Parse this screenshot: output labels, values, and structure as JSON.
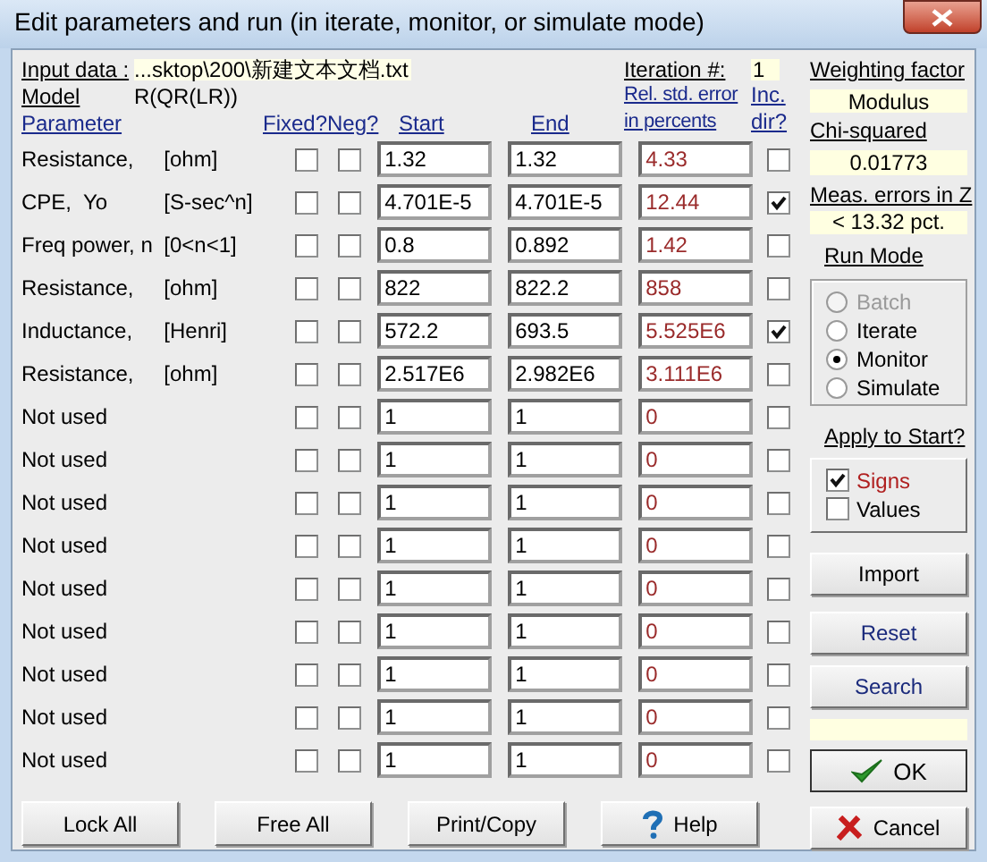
{
  "window": {
    "title": "Edit parameters and run (in iterate, monitor, or simulate mode)"
  },
  "header": {
    "input_data_label": "Input data :",
    "input_data_value": "...sktop\\200\\新建文本文档.txt",
    "model_label": "Model",
    "model_value": "R(QR(LR))",
    "iteration_label": "Iteration #:",
    "iteration_value": "1"
  },
  "columns": {
    "parameter": "Parameter",
    "fixed": "Fixed?",
    "neg": "Neg?",
    "start": "Start",
    "end": "End",
    "error": "Rel. std. error in percents",
    "inc_dir": "Inc. dir?"
  },
  "rows": [
    {
      "name": "Resistance,",
      "unit": "[ohm]",
      "fixed": false,
      "neg": false,
      "start": "1.32",
      "end": "1.32",
      "error": "4.33",
      "inc_dir": false
    },
    {
      "name": "CPE,  Yo",
      "unit": "[S-sec^n]",
      "fixed": false,
      "neg": false,
      "start": "4.701E-5",
      "end": "4.701E-5",
      "error": "12.44",
      "inc_dir": true
    },
    {
      "name": "Freq power, n",
      "unit": "[0<n<1]",
      "fixed": false,
      "neg": false,
      "start": "0.8",
      "end": "0.892",
      "error": "1.42",
      "inc_dir": false
    },
    {
      "name": "Resistance,",
      "unit": "[ohm]",
      "fixed": false,
      "neg": false,
      "start": "822",
      "end": "822.2",
      "error": "858",
      "inc_dir": false
    },
    {
      "name": "Inductance,",
      "unit": "[Henri]",
      "fixed": false,
      "neg": false,
      "start": "572.2",
      "end": "693.5",
      "error": "5.525E6",
      "inc_dir": true
    },
    {
      "name": "Resistance,",
      "unit": "[ohm]",
      "fixed": false,
      "neg": false,
      "start": "2.517E6",
      "end": "2.982E6",
      "error": "3.111E6",
      "inc_dir": false
    },
    {
      "name": "Not used",
      "fixed": false,
      "neg": false,
      "start": "1",
      "end": "1",
      "error": "0",
      "inc_dir": false
    },
    {
      "name": "Not used",
      "fixed": false,
      "neg": false,
      "start": "1",
      "end": "1",
      "error": "0",
      "inc_dir": false
    },
    {
      "name": "Not used",
      "fixed": false,
      "neg": false,
      "start": "1",
      "end": "1",
      "error": "0",
      "inc_dir": false
    },
    {
      "name": "Not used",
      "fixed": false,
      "neg": false,
      "start": "1",
      "end": "1",
      "error": "0",
      "inc_dir": false
    },
    {
      "name": "Not used",
      "fixed": false,
      "neg": false,
      "start": "1",
      "end": "1",
      "error": "0",
      "inc_dir": false
    },
    {
      "name": "Not used",
      "fixed": false,
      "neg": false,
      "start": "1",
      "end": "1",
      "error": "0",
      "inc_dir": false
    },
    {
      "name": "Not used",
      "fixed": false,
      "neg": false,
      "start": "1",
      "end": "1",
      "error": "0",
      "inc_dir": false
    },
    {
      "name": "Not used",
      "fixed": false,
      "neg": false,
      "start": "1",
      "end": "1",
      "error": "0",
      "inc_dir": false
    },
    {
      "name": "Not used",
      "fixed": false,
      "neg": false,
      "start": "1",
      "end": "1",
      "error": "0",
      "inc_dir": false
    }
  ],
  "bottom_buttons": [
    {
      "label": "Lock All",
      "kind": "plain"
    },
    {
      "label": "Free All",
      "kind": "plain"
    },
    {
      "label": "Print/Copy",
      "kind": "plain"
    },
    {
      "label": "Help",
      "kind": "help"
    }
  ],
  "side": {
    "weighting_label": "Weighting factor",
    "weighting_value": "Modulus",
    "chi_label": "Chi-squared",
    "chi_value": "0.01773",
    "meas_label": "Meas. errors in Z",
    "meas_value": "< 13.32 pct.",
    "run_mode": {
      "title": "Run Mode",
      "options": [
        {
          "label": "Batch",
          "selected": false,
          "disabled": true
        },
        {
          "label": "Iterate",
          "selected": false,
          "disabled": false
        },
        {
          "label": "Monitor",
          "selected": true,
          "disabled": false
        },
        {
          "label": "Simulate",
          "selected": false,
          "disabled": false
        }
      ]
    },
    "apply": {
      "title": "Apply to Start?",
      "options": [
        {
          "label": "Signs",
          "checked": true
        },
        {
          "label": "Values",
          "checked": false
        }
      ]
    },
    "buttons": [
      {
        "label": "Import",
        "kind": "plain"
      },
      {
        "label": "Reset",
        "kind": "action"
      },
      {
        "label": "Search",
        "kind": "action"
      }
    ],
    "ok": "OK",
    "cancel": "Cancel"
  }
}
